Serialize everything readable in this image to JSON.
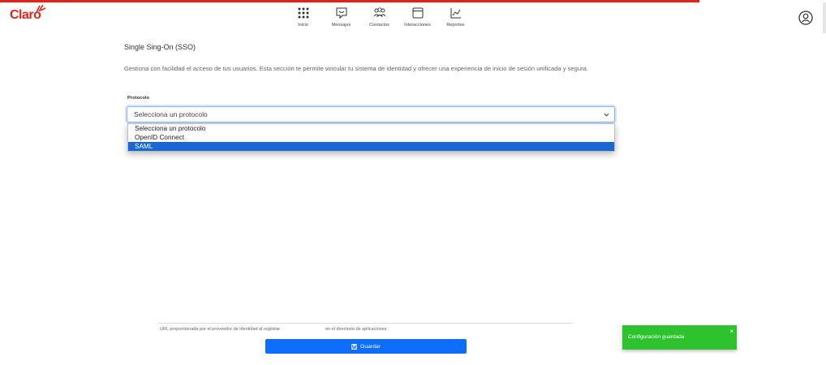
{
  "brand": {
    "logo_text": "Claro",
    "color": "#e2231a"
  },
  "nav": {
    "items": [
      {
        "label": "Inicio",
        "icon": "grid-icon"
      },
      {
        "label": "Mensajes",
        "icon": "message-icon"
      },
      {
        "label": "Contactos",
        "icon": "contacts-icon"
      },
      {
        "label": "Interacciones",
        "icon": "window-icon"
      },
      {
        "label": "Reportes",
        "icon": "chart-icon"
      }
    ]
  },
  "header": {
    "user_icon": "user-circle-icon"
  },
  "page": {
    "title": "Single Sing-On (SSO)",
    "description": "Gestiona con facilidad el acceso de tus usuarios. Esta sección te permite vincular tu sistema de identidad y ofrecer una experiencia de inicio de sesión unificada y segura."
  },
  "form": {
    "protocol_label": "Protocolo",
    "protocol_value": "Selecciona un protocolo",
    "options": [
      "Selecciona un protocolo",
      "OpenID Connect",
      "SAML"
    ],
    "highlighted_option": "SAML",
    "hint_left": "URL proporcionada por el proveedor de identidad al registrar",
    "hint_right": "en el directorio de aplicaciones.",
    "save_label": "Guardar"
  },
  "toast": {
    "message": "Configuración guardada",
    "close": "×",
    "color": "#2ec32e"
  },
  "colors": {
    "accent": "#0d6efd",
    "highlight": "#1967d2"
  }
}
